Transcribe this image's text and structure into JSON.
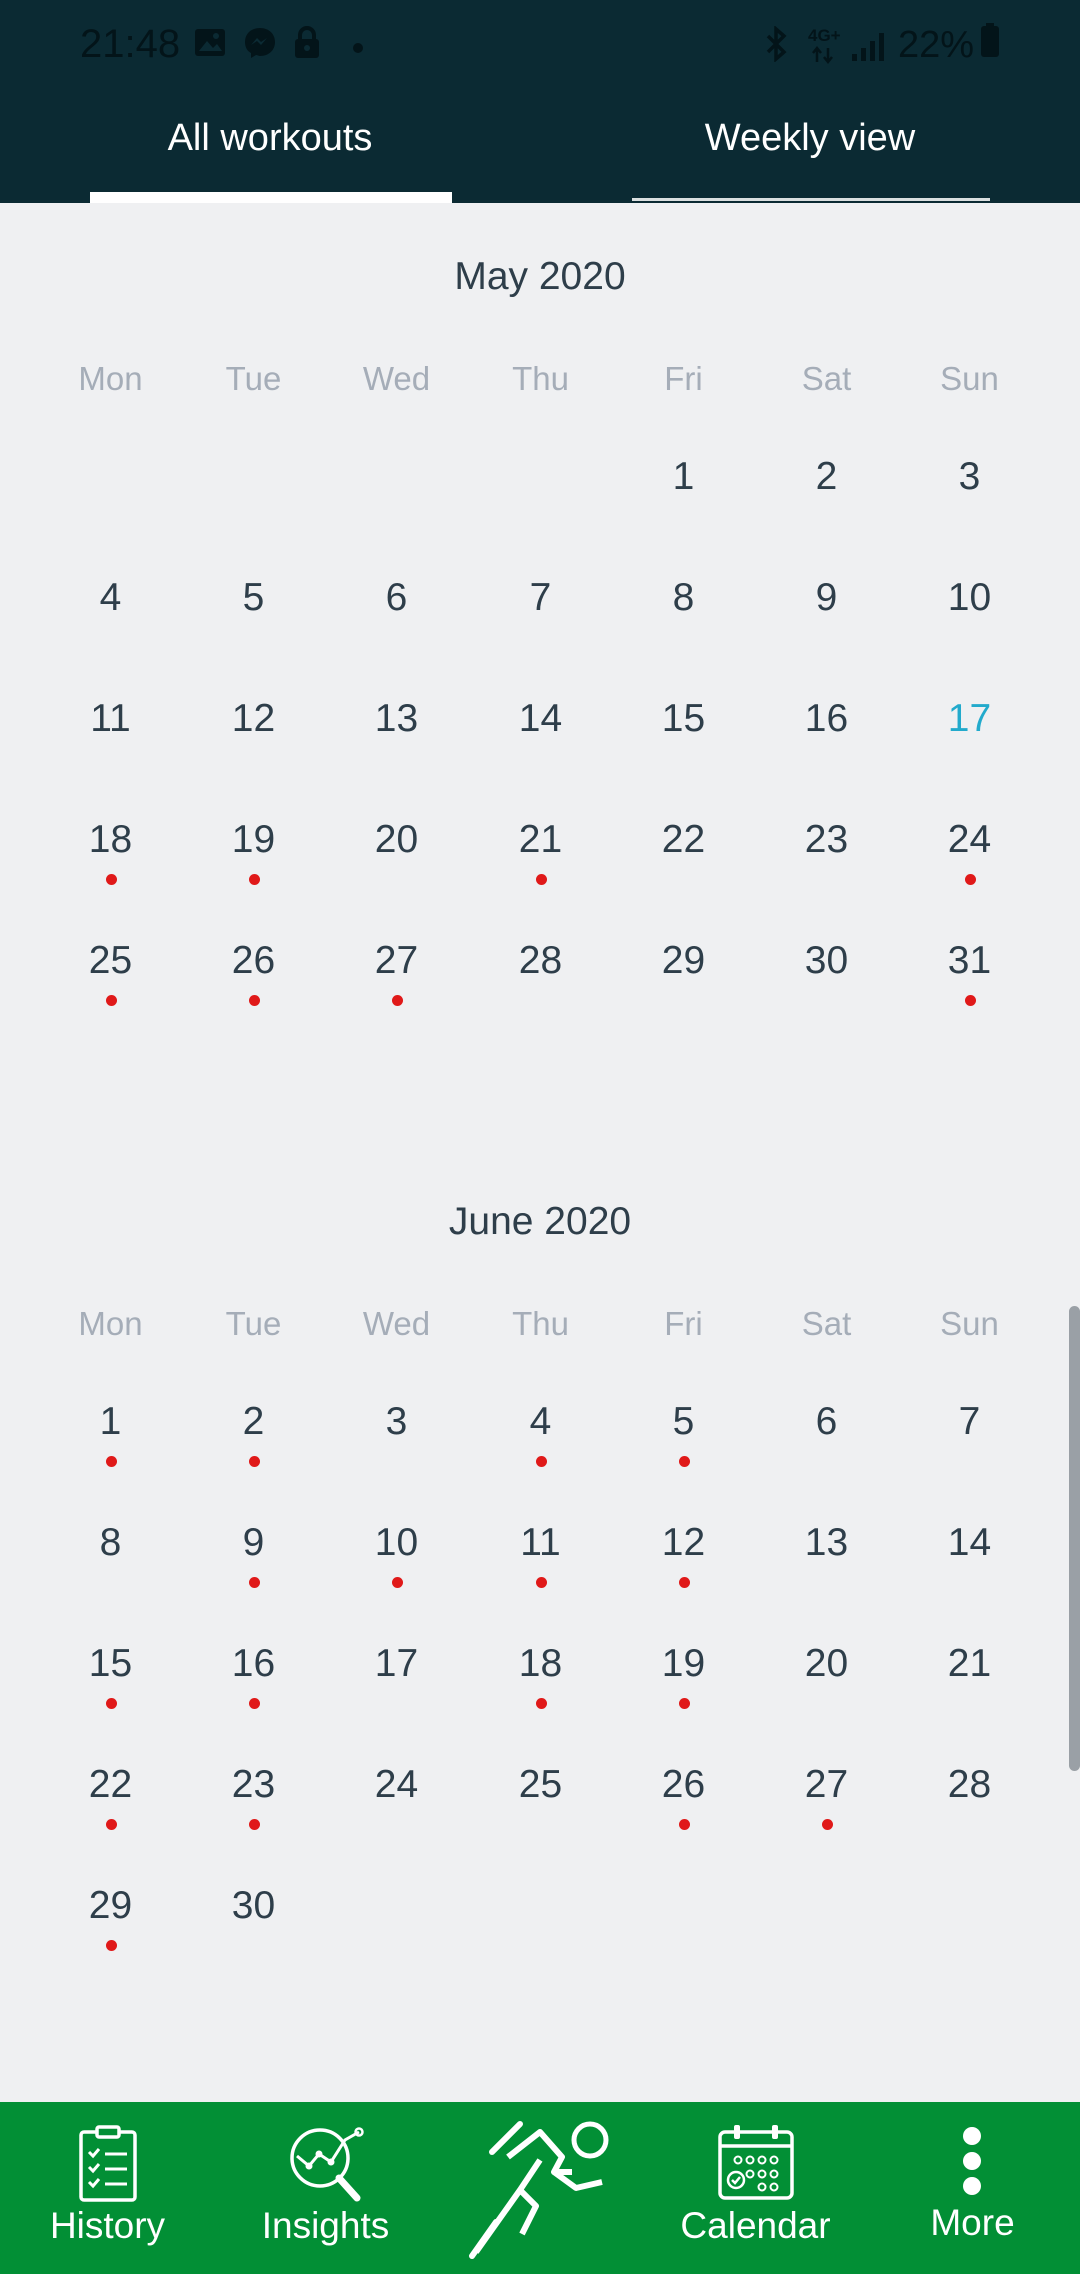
{
  "status_bar": {
    "time": "21:48",
    "network": "4G+",
    "battery": "22%"
  },
  "tabs": [
    {
      "label": "All workouts",
      "active": true
    },
    {
      "label": "Weekly view",
      "active": false
    }
  ],
  "calendar": {
    "weekdays": [
      "Mon",
      "Tue",
      "Wed",
      "Thu",
      "Fri",
      "Sat",
      "Sun"
    ],
    "today_color": "#22aacc",
    "dot_color": "#e01919",
    "months": [
      {
        "title": "May 2020",
        "weeks": [
          [
            null,
            null,
            null,
            null,
            {
              "d": "1"
            },
            {
              "d": "2"
            },
            {
              "d": "3"
            }
          ],
          [
            {
              "d": "4"
            },
            {
              "d": "5"
            },
            {
              "d": "6"
            },
            {
              "d": "7"
            },
            {
              "d": "8"
            },
            {
              "d": "9"
            },
            {
              "d": "10"
            }
          ],
          [
            {
              "d": "11"
            },
            {
              "d": "12"
            },
            {
              "d": "13"
            },
            {
              "d": "14"
            },
            {
              "d": "15"
            },
            {
              "d": "16"
            },
            {
              "d": "17",
              "today": true
            }
          ],
          [
            {
              "d": "18",
              "dot": true
            },
            {
              "d": "19",
              "dot": true
            },
            {
              "d": "20"
            },
            {
              "d": "21",
              "dot": true
            },
            {
              "d": "22"
            },
            {
              "d": "23"
            },
            {
              "d": "24",
              "dot": true
            }
          ],
          [
            {
              "d": "25",
              "dot": true
            },
            {
              "d": "26",
              "dot": true
            },
            {
              "d": "27",
              "dot": true
            },
            {
              "d": "28"
            },
            {
              "d": "29"
            },
            {
              "d": "30"
            },
            {
              "d": "31",
              "dot": true
            }
          ]
        ]
      },
      {
        "title": "June 2020",
        "weeks": [
          [
            {
              "d": "1",
              "dot": true
            },
            {
              "d": "2",
              "dot": true
            },
            {
              "d": "3"
            },
            {
              "d": "4",
              "dot": true
            },
            {
              "d": "5",
              "dot": true
            },
            {
              "d": "6"
            },
            {
              "d": "7"
            }
          ],
          [
            {
              "d": "8"
            },
            {
              "d": "9",
              "dot": true
            },
            {
              "d": "10",
              "dot": true
            },
            {
              "d": "11",
              "dot": true
            },
            {
              "d": "12",
              "dot": true
            },
            {
              "d": "13"
            },
            {
              "d": "14"
            }
          ],
          [
            {
              "d": "15",
              "dot": true
            },
            {
              "d": "16",
              "dot": true
            },
            {
              "d": "17"
            },
            {
              "d": "18",
              "dot": true
            },
            {
              "d": "19",
              "dot": true
            },
            {
              "d": "20"
            },
            {
              "d": "21"
            }
          ],
          [
            {
              "d": "22",
              "dot": true
            },
            {
              "d": "23",
              "dot": true
            },
            {
              "d": "24"
            },
            {
              "d": "25"
            },
            {
              "d": "26",
              "dot": true
            },
            {
              "d": "27",
              "dot": true
            },
            {
              "d": "28"
            }
          ],
          [
            {
              "d": "29",
              "dot": true
            },
            {
              "d": "30"
            },
            null,
            null,
            null,
            null,
            null
          ]
        ]
      }
    ]
  },
  "bottom_nav": {
    "background": "#028f35",
    "items": [
      {
        "label": "History",
        "icon": "clipboard-checklist-icon"
      },
      {
        "label": "Insights",
        "icon": "magnifier-chart-icon"
      },
      {
        "label": "",
        "icon": "runner-icon"
      },
      {
        "label": "Calendar",
        "icon": "calendar-icon"
      },
      {
        "label": "More",
        "icon": "more-vertical-icon"
      }
    ]
  }
}
